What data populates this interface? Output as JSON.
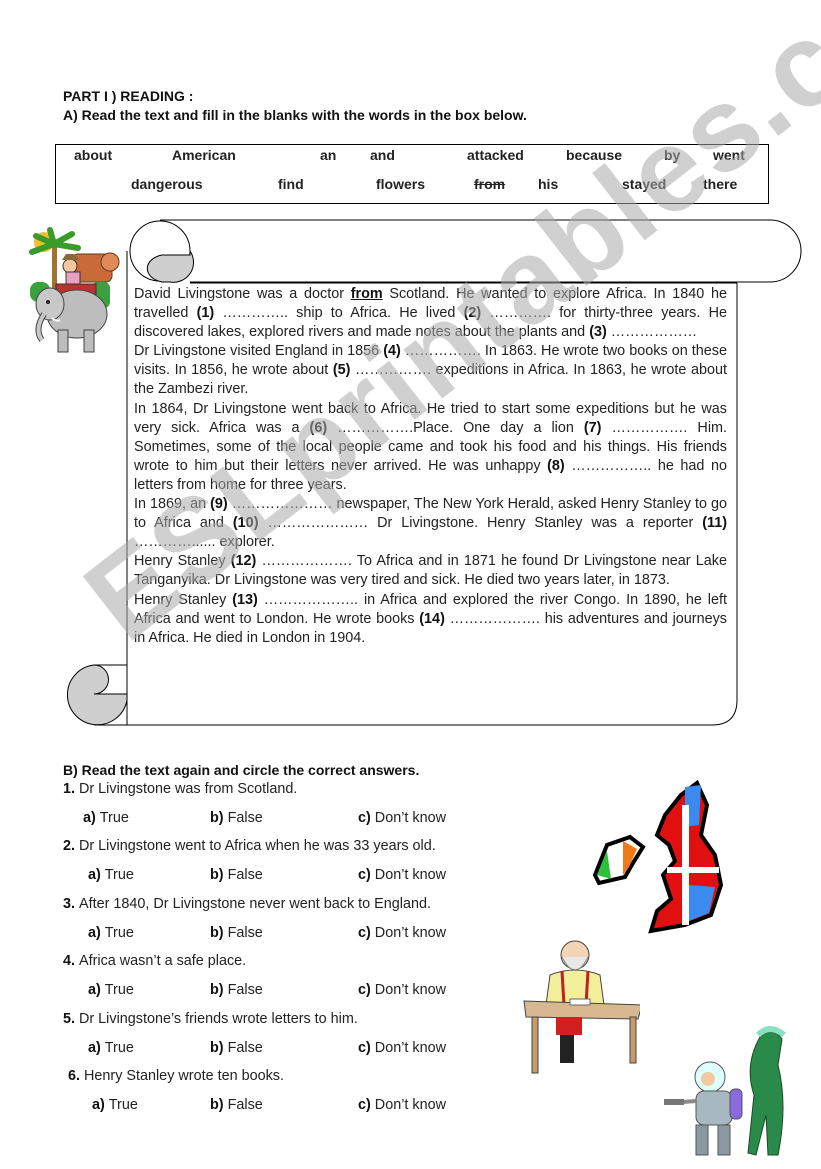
{
  "header": {
    "part_title": "PART I ) READING :",
    "instruction_a": "A) Read the text and fill in the blanks with the words in the box below."
  },
  "word_box": {
    "row1": [
      "about",
      "American",
      "an",
      "and",
      "attacked",
      "because",
      "by",
      "went"
    ],
    "row2": [
      "dangerous",
      "find",
      "flowers",
      "from",
      "his",
      "stayed",
      "there"
    ],
    "struck_word": "from"
  },
  "reading": {
    "paragraphs": [
      [
        "David Livingstone was a doctor ",
        {
          "given": "from"
        },
        " Scotland. He wanted to explore Africa. In 1840 he travelled ",
        {
          "blank": "(1)"
        },
        " ………….. ship to Africa. He lived ",
        {
          "blank": "(2)"
        },
        " …………. for thirty-three years. He discovered lakes, explored rivers and made notes about the plants and ",
        {
          "blank": "(3)"
        },
        " ………………"
      ],
      [
        "Dr Livingstone visited England in 1856 ",
        {
          "blank": "(4)"
        },
        " ……………. In 1863. He wrote two books on these visits. In 1856, he wrote about ",
        {
          "blank": "(5)"
        },
        " ……………. expeditions in Africa. In 1863, he wrote about the Zambezi river."
      ],
      [
        "In 1864, Dr Livingstone went back to Africa. He tried to start some expeditions but he was very sick. Africa was a ",
        {
          "blank": "(6)"
        },
        " …………….Place. One day a lion ",
        {
          "blank": "(7)"
        },
        " ……………. Him. Sometimes, some of the local people came and took his food and his things. His friends wrote to him but their letters never arrived. He was unhappy ",
        {
          "blank": "(8)"
        },
        " …………….. he had no letters from home for three years."
      ],
      [
        "In 1869, an ",
        {
          "blank": "(9)"
        },
        " ………………… newspaper, The New York Herald, asked Henry Stanley to go to Africa and ",
        {
          "blank": "(10)"
        },
        " ………………… Dr Livingstone. Henry Stanley was a reporter ",
        {
          "blank": "(11)"
        },
        " …………...... explorer."
      ],
      [
        "Henry Stanley ",
        {
          "blank": "(12)"
        },
        " ………………. To Africa and in 1871 he found Dr Livingstone near Lake Tanganyika. Dr Livingstone was very tired and sick. He died two years later, in 1873."
      ],
      [
        "Henry Stanley ",
        {
          "blank": "(13)"
        },
        " ……………….. in Africa and explored the river Congo. In 1890, he left Africa and went to London. He wrote books ",
        {
          "blank": "(14)"
        },
        " ………………. his adventures and journeys in Africa. He died in London in 1904."
      ]
    ]
  },
  "section_b": {
    "instruction": "B) Read the text again and circle the correct answers.",
    "questions": [
      {
        "num": "1.",
        "text": "Dr Livingstone was from Scotland."
      },
      {
        "num": "2.",
        "text": "Dr Livingstone went to Africa when he was 33 years old."
      },
      {
        "num": "3.",
        "text": "After 1840, Dr Livingstone never went back to England."
      },
      {
        "num": "4.",
        "text": "Africa wasn’t a safe place."
      },
      {
        "num": "5.",
        "text": "Dr Livingstone’s friends wrote letters to him."
      },
      {
        "num": "6.",
        "text": "Henry Stanley wrote ten books."
      }
    ],
    "options": [
      {
        "letter": "a)",
        "label": "True"
      },
      {
        "letter": "b)",
        "label": "False"
      },
      {
        "letter": "c)",
        "label": "Don’t know"
      }
    ]
  },
  "images": {
    "explorer_on_elephant": "explorer-elephant-illustration",
    "british_isles_map": "british-isles-flag-map",
    "old_man_writing": "old-man-at-desk-illustration",
    "astronaut_alien": "astronaut-alien-illustration"
  },
  "watermark": "ESLprintables.com"
}
